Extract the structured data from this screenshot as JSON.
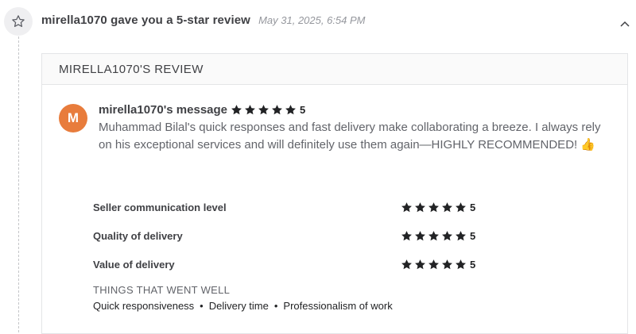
{
  "event": {
    "text": "mirella1070 gave you a 5-star review",
    "time": "May 31, 2025, 6:54 PM",
    "icon": "star-outline-icon",
    "collapse_icon": "chevron-up-icon"
  },
  "review": {
    "header": "MIRELLA1070'S REVIEW",
    "avatar_initial": "M",
    "avatar_color": "#e87c3c",
    "message_title": "mirella1070's message",
    "overall_rating": "5",
    "overall_stars": 5,
    "message": "Muhammad Bilal's quick responses and fast delivery make collaborating a breeze. I always rely on his exceptional services and will definitely use them again—HIGHLY RECOMMENDED! 👍",
    "ratings": [
      {
        "label": "Seller communication level",
        "value": "5",
        "stars": 5
      },
      {
        "label": "Quality of delivery",
        "value": "5",
        "stars": 5
      },
      {
        "label": "Value of delivery",
        "value": "5",
        "stars": 5
      }
    ],
    "went_well_title": "THINGS THAT WENT WELL",
    "went_well": [
      "Quick responsiveness",
      "Delivery time",
      "Professionalism of work"
    ],
    "separator": "•",
    "star_color": "#222325"
  }
}
